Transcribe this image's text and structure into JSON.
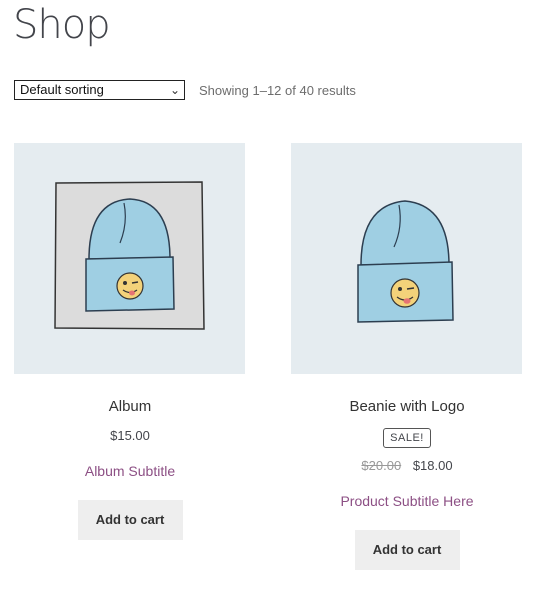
{
  "page": {
    "title": "Shop"
  },
  "toolbar": {
    "sort_selected": "Default sorting",
    "result_count": "Showing 1–12 of 40 results"
  },
  "products": [
    {
      "title": "Album",
      "price": "$15.00",
      "subtitle": "Album Subtitle",
      "add_to_cart": "Add to cart"
    },
    {
      "title": "Beanie with Logo",
      "sale_badge": "SALE!",
      "old_price": "$20.00",
      "price": "$18.00",
      "subtitle": "Product Subtitle Here",
      "add_to_cart": "Add to cart"
    }
  ],
  "colors": {
    "subtitle": "#8c4f84",
    "thumb_bg": "#e5ecf0",
    "beanie": "#9fcfe3",
    "button_bg": "#eeeeee"
  }
}
